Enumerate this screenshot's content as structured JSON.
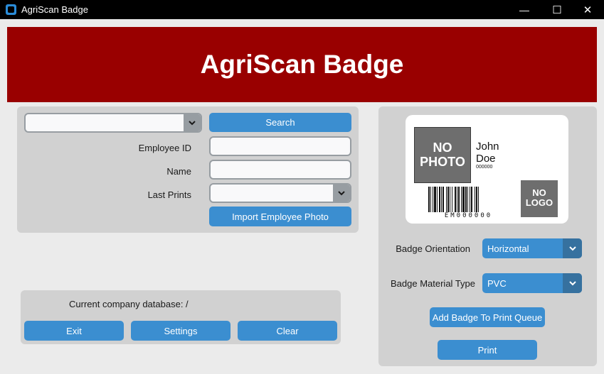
{
  "window": {
    "title": "AgriScan Badge",
    "controls": {
      "minimize": "—",
      "maximize": "☐",
      "close": "✕"
    }
  },
  "header": {
    "title": "AgriScan Badge",
    "background": "#990000"
  },
  "lookup": {
    "employee_select": {
      "value": ""
    },
    "search_label": "Search",
    "employee_id_label": "Employee ID",
    "employee_id_value": "",
    "name_label": "Name",
    "name_value": "",
    "last_prints_label": "Last Prints",
    "last_prints_value": "",
    "import_photo_label": "Import Employee Photo"
  },
  "footer": {
    "database_text": "Current company database: /",
    "exit_label": "Exit",
    "settings_label": "Settings",
    "clear_label": "Clear"
  },
  "badge_preview": {
    "photo_text_line1": "NO",
    "photo_text_line2": "PHOTO",
    "first_name": "John",
    "last_name": "Doe",
    "employee_number": "000000",
    "barcode_text": "EM000000",
    "logo_text_line1": "NO",
    "logo_text_line2": "LOGO"
  },
  "options": {
    "orientation_label": "Badge Orientation",
    "orientation_value": "Horizontal",
    "material_label": "Badge Material Type",
    "material_value": "PVC",
    "add_queue_label": "Add Badge To Print Queue",
    "print_label": "Print"
  },
  "colors": {
    "accent": "#3b8ed0",
    "accent_dark": "#36719f",
    "frame": "#d1d1d1"
  }
}
